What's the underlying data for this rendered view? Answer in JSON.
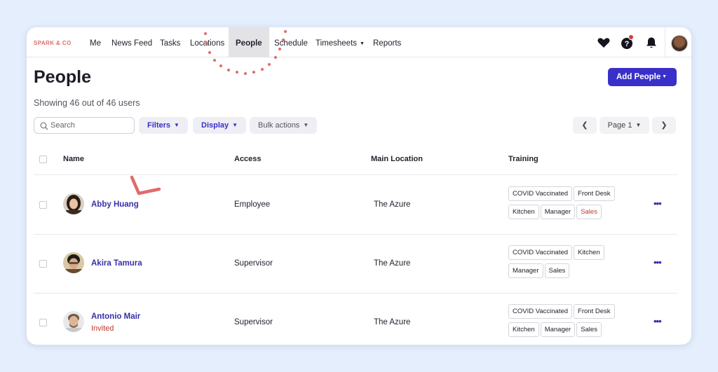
{
  "brand": "SPARK & CO",
  "nav": {
    "items": [
      {
        "label": "Me"
      },
      {
        "label": "News Feed"
      },
      {
        "label": "Tasks"
      },
      {
        "label": "Locations"
      },
      {
        "label": "People"
      },
      {
        "label": "Schedule"
      },
      {
        "label": "Timesheets"
      },
      {
        "label": "Reports"
      }
    ],
    "active": "People",
    "icons": [
      "heart-icon",
      "help-icon",
      "bell-icon"
    ],
    "notification_color": "#d73a3a"
  },
  "page": {
    "title": "People",
    "add_button": "Add People",
    "showing": "Showing 46 out of 46 users"
  },
  "toolbar": {
    "search_placeholder": "Search",
    "filters": "Filters",
    "display": "Display",
    "bulk_actions": "Bulk actions",
    "page_label": "Page 1"
  },
  "table": {
    "headers": {
      "name": "Name",
      "access": "Access",
      "location": "Main Location",
      "training": "Training"
    },
    "rows": [
      {
        "name": "Abby Huang",
        "status": "",
        "access": "Employee",
        "location": "The Azure",
        "training": [
          {
            "label": "COVID Vaccinated",
            "alert": false
          },
          {
            "label": "Front Desk",
            "alert": false
          },
          {
            "label": "Kitchen",
            "alert": false
          },
          {
            "label": "Manager",
            "alert": false
          },
          {
            "label": "Sales",
            "alert": true
          }
        ]
      },
      {
        "name": "Akira Tamura",
        "status": "",
        "access": "Supervisor",
        "location": "The Azure",
        "training": [
          {
            "label": "COVID Vaccinated",
            "alert": false
          },
          {
            "label": "Kitchen",
            "alert": false
          },
          {
            "label": "Manager",
            "alert": false
          },
          {
            "label": "Sales",
            "alert": false
          }
        ]
      },
      {
        "name": "Antonio Mair",
        "status": "Invited",
        "access": "Supervisor",
        "location": "The Azure",
        "training": [
          {
            "label": "COVID Vaccinated",
            "alert": false
          },
          {
            "label": "Front Desk",
            "alert": false
          },
          {
            "label": "Kitchen",
            "alert": false
          },
          {
            "label": "Manager",
            "alert": false
          },
          {
            "label": "Sales",
            "alert": false
          }
        ]
      }
    ]
  },
  "colors": {
    "accent": "#3a2fc9",
    "link": "#3a2fa8",
    "alert": "#c0392b",
    "background": "#e4eefc",
    "annotation": "#e06a6a"
  }
}
